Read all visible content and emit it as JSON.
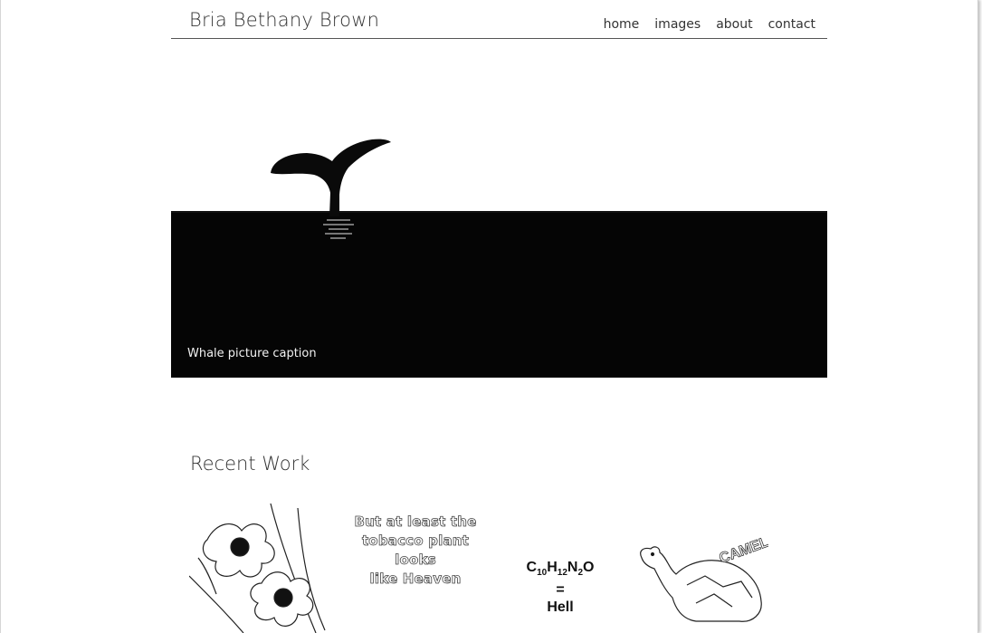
{
  "header": {
    "site_title": "Bria Bethany Brown",
    "nav": [
      "home",
      "images",
      "about",
      "contact"
    ]
  },
  "hero": {
    "caption": "Whale picture caption"
  },
  "recent_work": {
    "title": "Recent Work",
    "items": [
      {
        "name": "flowers-drawing"
      },
      {
        "name": "tobacco-text",
        "text_lines": [
          "But at least the",
          "tobacco plant looks",
          "like Heaven"
        ]
      },
      {
        "name": "formula",
        "formula": "C10H12N2O",
        "equals": "=",
        "word": "Hell"
      },
      {
        "name": "camel-drawing",
        "label": "CAMEL"
      }
    ]
  }
}
